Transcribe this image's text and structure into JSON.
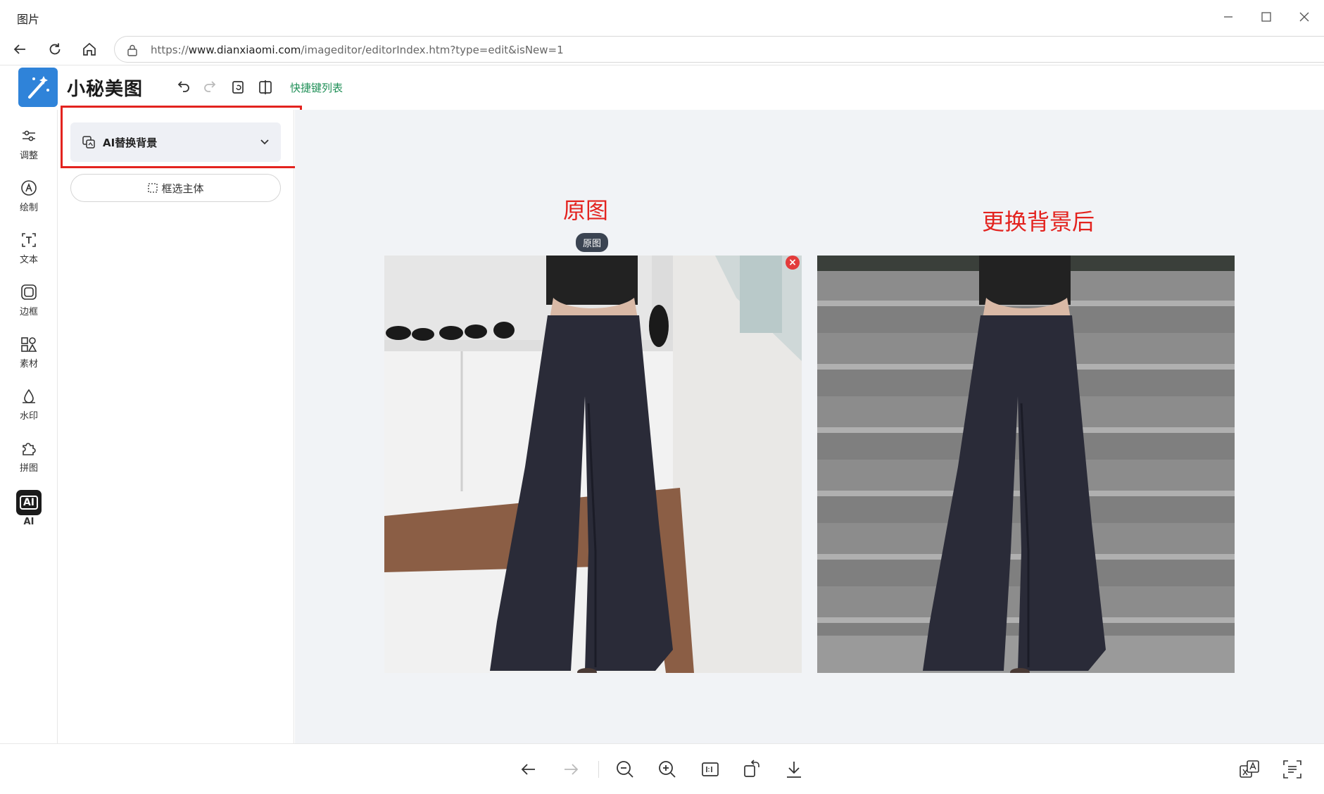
{
  "window": {
    "title": "图片"
  },
  "browser": {
    "url_prefix": "https://",
    "url_domain": "www.dianxiaomi.com",
    "url_path": "/imageditor/editorIndex.htm?type=edit&isNew=1"
  },
  "app": {
    "brand": "小秘美图",
    "shortcut_link": "快捷键列表"
  },
  "rail": {
    "items": [
      {
        "label": "调整",
        "icon": "sliders-icon"
      },
      {
        "label": "绘制",
        "icon": "pen-icon"
      },
      {
        "label": "文本",
        "icon": "text-icon"
      },
      {
        "label": "边框",
        "icon": "frame-icon"
      },
      {
        "label": "素材",
        "icon": "shapes-icon"
      },
      {
        "label": "水印",
        "icon": "watermark-icon"
      },
      {
        "label": "拼图",
        "icon": "puzzle-icon"
      },
      {
        "label": "AI",
        "icon": "ai-icon",
        "glyph": "AI",
        "active": true
      }
    ]
  },
  "panel": {
    "ai_select_label": "AI替换背景",
    "select_subject_label": "框选主体"
  },
  "canvas": {
    "caption_left": "原图",
    "caption_right": "更换背景后",
    "original_badge": "原图",
    "close_glyph": "×",
    "caption_color": "#e3231f"
  },
  "colors": {
    "brand_blue": "#2f83d9",
    "link_green": "#1e8f56",
    "highlight_red": "#e3231f"
  }
}
